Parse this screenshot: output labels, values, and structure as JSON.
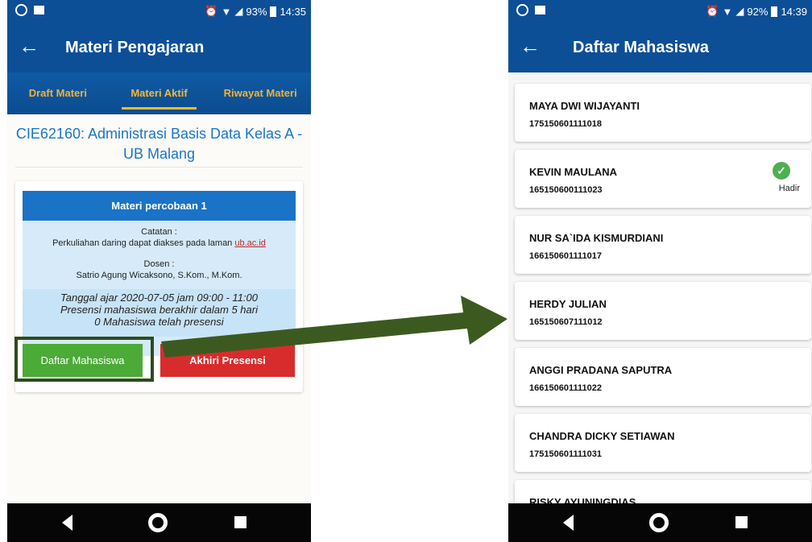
{
  "left": {
    "status_time": "14:35",
    "status_battery": "93%",
    "back_icon": "←",
    "title": "Materi Pengajaran",
    "tabs": [
      {
        "label": "Draft Materi"
      },
      {
        "label": "Materi Aktif"
      },
      {
        "label": "Riwayat Materi"
      }
    ],
    "course_title": "CIE62160: Administrasi Basis Data Kelas A - UB Malang",
    "card": {
      "header": "Materi percobaan 1",
      "note_label": "Catatan :",
      "note_text": "Perkuliahan daring dapat diakses pada laman ",
      "note_link": "ub.ac.id",
      "dosen_label": "Dosen :",
      "dosen_name": "Satrio Agung Wicaksono, S.Kom., M.Kom.",
      "info_line1": "Tanggal ajar 2020-07-05 jam 09:00 - 11:00",
      "info_line2": "Presensi mahasiswa berakhir dalam 5 hari",
      "info_line3": "0 Mahasiswa telah presensi",
      "btn_daftar": "Daftar Mahasiswa",
      "btn_presensi": "Akhiri Presensi"
    }
  },
  "right": {
    "status_time": "14:39",
    "status_battery": "92%",
    "back_icon": "←",
    "title": "Daftar Mahasiswa",
    "students": [
      {
        "name": "MAYA DWI WIJAYANTI",
        "id": "175150601111018",
        "status": ""
      },
      {
        "name": "KEVIN MAULANA",
        "id": "165150600111023",
        "status": "Hadir"
      },
      {
        "name": "NUR SA`IDA KISMURDIANI",
        "id": "166150601111017",
        "status": ""
      },
      {
        "name": "HERDY JULIAN",
        "id": "165150607111012",
        "status": ""
      },
      {
        "name": "ANGGI PRADANA SAPUTRA",
        "id": "166150601111022",
        "status": ""
      },
      {
        "name": "CHANDRA DICKY SETIAWAN",
        "id": "175150601111031",
        "status": ""
      },
      {
        "name": "RISKY AYUNINGDIAS",
        "id": "",
        "status": ""
      }
    ]
  },
  "colors": {
    "primary": "#0d4f97",
    "accent": "#f6b934",
    "green": "#4caa37",
    "red": "#d82c2c",
    "arrow": "#3c5a20"
  }
}
